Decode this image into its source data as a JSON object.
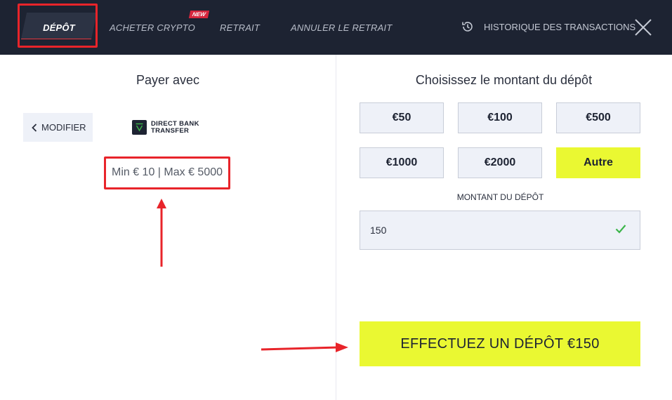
{
  "tabs": [
    {
      "label": "DÉPÔT",
      "active": true
    },
    {
      "label": "ACHETER CRYPTO",
      "badge": "NEW"
    },
    {
      "label": "RETRAIT"
    },
    {
      "label": "ANNULER LE RETRAIT"
    }
  ],
  "history": {
    "label": "HISTORIQUE DES TRANSACTIONS",
    "icon": "history-icon"
  },
  "close": {
    "icon": "close-icon"
  },
  "left": {
    "title": "Payer avec",
    "modify_label": "MODIFIER",
    "method_logo": {
      "line1": "DIRECT BANK",
      "line2": "TRANSFER"
    },
    "limits": "Min € 10 | Max € 5000"
  },
  "right": {
    "title": "Choisissez le montant du dépôt",
    "amounts": [
      {
        "label": "€50"
      },
      {
        "label": "€100"
      },
      {
        "label": "€500"
      },
      {
        "label": "€1000"
      },
      {
        "label": "€2000"
      },
      {
        "label": "Autre",
        "selected": true
      }
    ],
    "deposit_label": "MONTANT DU DÉPÔT",
    "deposit_value": "150",
    "submit_label": "EFFECTUEZ UN DÉPÔT €150"
  },
  "colors": {
    "topbar": "#1d2332",
    "accent_yellow": "#eaf832",
    "annotation_red": "#e8242a",
    "valid_green": "#3cb54a"
  }
}
